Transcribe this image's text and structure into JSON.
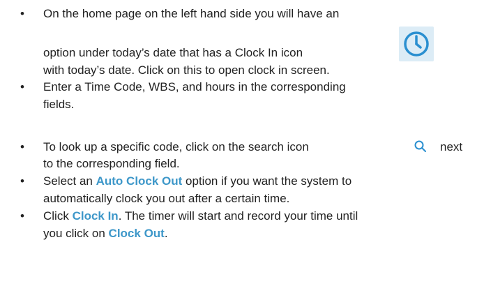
{
  "bullets": [
    {
      "lines": [
        "On the home page on the left hand side you will have an",
        "option under today’s date that has a Clock In icon",
        "with today’s date. Click on this to open clock in screen."
      ]
    },
    {
      "lines": [
        "Enter a Time Code, WBS, and hours in the corresponding",
        "fields."
      ]
    },
    {
      "lines_prefix": "To look up a specific code, click on the search icon",
      "lines_suffix": "next",
      "line2": "to the corresponding field."
    },
    {
      "p1": "Select an ",
      "hl1": "Auto Clock Out",
      "p2": " option if you want the system to",
      "line2": "automatically clock you out after a certain time."
    },
    {
      "p1": "Click ",
      "hl1": "Clock In",
      "p2": ". The timer will start and record your time until",
      "l2p1": "you click on ",
      "hl2": "Clock Out",
      "l2p2": "."
    }
  ],
  "bullet_glyph": "•",
  "icons": {
    "clock": "clock-icon",
    "search": "search-icon"
  },
  "colors": {
    "highlight": "#3d97c9",
    "icon_bg": "#dcecf6",
    "icon_stroke": "#2a8fd0"
  }
}
